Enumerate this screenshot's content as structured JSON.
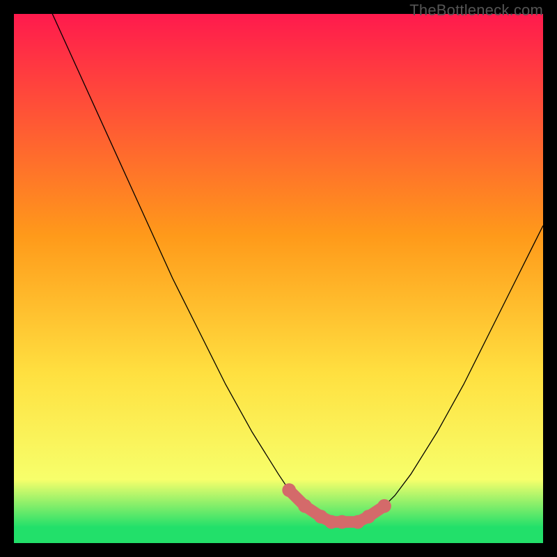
{
  "watermark": "TheBottleneck.com",
  "colors": {
    "bg": "#000000",
    "grad_top": "#ff1a4d",
    "grad_mid1": "#ff9a1a",
    "grad_mid2": "#ffe040",
    "grad_low": "#f7ff6b",
    "grad_green": "#22e06a",
    "curve": "#000000",
    "marker": "#d46a6a"
  },
  "chart_data": {
    "type": "line",
    "title": "",
    "xlabel": "",
    "ylabel": "",
    "xlim": [
      0,
      100
    ],
    "ylim": [
      0,
      100
    ],
    "series": [
      {
        "name": "curve",
        "x": [
          0,
          5,
          10,
          15,
          20,
          25,
          30,
          35,
          40,
          45,
          50,
          52,
          55,
          58,
          60,
          62,
          65,
          67,
          70,
          72,
          75,
          80,
          85,
          90,
          95,
          100
        ],
        "y": [
          116,
          105,
          94,
          83,
          72,
          61,
          50,
          40,
          30,
          21,
          13,
          10,
          7,
          5,
          4,
          4,
          4,
          5,
          7,
          9,
          13,
          21,
          30,
          40,
          50,
          60
        ]
      },
      {
        "name": "markers",
        "x": [
          52,
          55,
          58,
          60,
          62,
          65,
          67,
          70
        ],
        "y": [
          10,
          7,
          5,
          4,
          4,
          4,
          5,
          7
        ]
      }
    ]
  }
}
